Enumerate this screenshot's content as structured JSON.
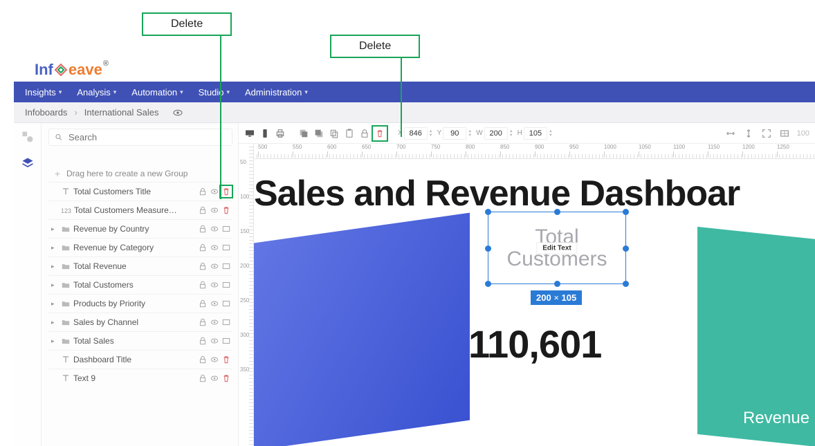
{
  "annotations": {
    "delete1": "Delete",
    "delete2": "Delete"
  },
  "logo": {
    "part1": "Inf",
    "part2": "eave"
  },
  "nav": {
    "insights": "Insights",
    "analysis": "Analysis",
    "automation": "Automation",
    "studio": "Studio",
    "administration": "Administration"
  },
  "breadcrumb": {
    "root": "Infoboards",
    "leaf": "International Sales"
  },
  "sidebar": {
    "search_placeholder": "Search",
    "drag_hint": "Drag here to create a new Group",
    "layers": [
      {
        "type": "text",
        "label": "Total Customers Title",
        "expandable": false,
        "actions": [
          "lock",
          "eye",
          "trash-hl"
        ]
      },
      {
        "type": "num",
        "label": "Total Customers Measure…",
        "expandable": false,
        "actions": [
          "lock",
          "eye",
          "trash"
        ]
      },
      {
        "type": "folder",
        "label": "Revenue by Country",
        "expandable": true,
        "actions": [
          "lock",
          "eye",
          "frame"
        ]
      },
      {
        "type": "folder",
        "label": "Revenue by Category",
        "expandable": true,
        "actions": [
          "lock",
          "eye",
          "frame"
        ]
      },
      {
        "type": "folder",
        "label": "Total Revenue",
        "expandable": true,
        "actions": [
          "lock",
          "eye",
          "frame"
        ]
      },
      {
        "type": "folder",
        "label": "Total Customers",
        "expandable": true,
        "actions": [
          "lock",
          "eye",
          "frame"
        ]
      },
      {
        "type": "folder",
        "label": "Products by Priority",
        "expandable": true,
        "actions": [
          "lock",
          "eye",
          "frame"
        ]
      },
      {
        "type": "folder",
        "label": "Sales by Channel",
        "expandable": true,
        "actions": [
          "lock",
          "eye",
          "frame"
        ]
      },
      {
        "type": "folder",
        "label": "Total Sales",
        "expandable": true,
        "actions": [
          "lock",
          "eye",
          "frame"
        ]
      },
      {
        "type": "text",
        "label": "Dashboard Title",
        "expandable": false,
        "actions": [
          "lock",
          "eye",
          "trash"
        ]
      },
      {
        "type": "text",
        "label": "Text 9",
        "expandable": false,
        "actions": [
          "lock",
          "eye",
          "trash"
        ]
      }
    ]
  },
  "toolbar": {
    "x": {
      "label": "X",
      "value": "846"
    },
    "y": {
      "label": "Y",
      "value": "90"
    },
    "w": {
      "label": "W",
      "value": "200"
    },
    "h": {
      "label": "H",
      "value": "105"
    },
    "zoom": "100"
  },
  "ruler_h": [
    "500",
    "550",
    "600",
    "650",
    "700",
    "750",
    "800",
    "850",
    "900",
    "950",
    "1000",
    "1050",
    "1100",
    "1150",
    "1200",
    "1250"
  ],
  "ruler_v": [
    "50",
    "100",
    "150",
    "200",
    "250",
    "300",
    "350"
  ],
  "canvas": {
    "headline": "Sales and Revenue Dashboar",
    "sel_text1": "Total",
    "sel_text2": "Customers",
    "edit_text": "Edit Text",
    "size_chip_w": "200",
    "size_chip_h": "105",
    "metric": "110,601",
    "rev_label": "Revenue by C"
  }
}
